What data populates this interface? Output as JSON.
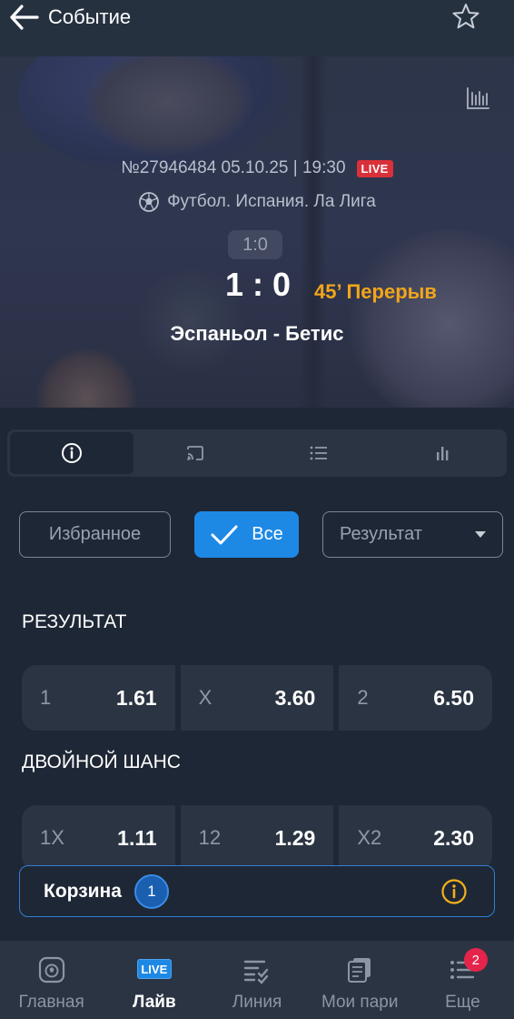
{
  "header": {
    "title": "Событие"
  },
  "event": {
    "meta": "№27946484 05.10.25 | 19:30",
    "live_label": "LIVE",
    "league": "Футбол. Испания. Ла Лига",
    "prev_score": "1:0",
    "score": "1 : 0",
    "period": "45’ Перерыв",
    "teams": "Эспаньол - Бетис"
  },
  "filters": {
    "favorites": "Избранное",
    "all": "Все",
    "market_select": "Результат"
  },
  "markets": [
    {
      "title": "РЕЗУЛЬТАТ",
      "outcomes": [
        {
          "label": "1",
          "odd": "1.61"
        },
        {
          "label": "X",
          "odd": "3.60"
        },
        {
          "label": "2",
          "odd": "6.50"
        }
      ]
    },
    {
      "title": "ДВОЙНОЙ ШАНС",
      "outcomes": [
        {
          "label": "1X",
          "odd": "1.11"
        },
        {
          "label": "12",
          "odd": "1.29"
        },
        {
          "label": "X2",
          "odd": "2.30"
        }
      ]
    }
  ],
  "cart": {
    "label": "Корзина",
    "count": "1"
  },
  "nav": {
    "items": [
      {
        "label": "Главная"
      },
      {
        "label": "Лайв",
        "badge": "LIVE"
      },
      {
        "label": "Линия"
      },
      {
        "label": "Мои пари"
      },
      {
        "label": "Еще",
        "count": "2"
      }
    ]
  },
  "colors": {
    "accent": "#1e88e5",
    "live": "#d9303a",
    "period": "#f2a51c",
    "info": "#f2b01c"
  }
}
